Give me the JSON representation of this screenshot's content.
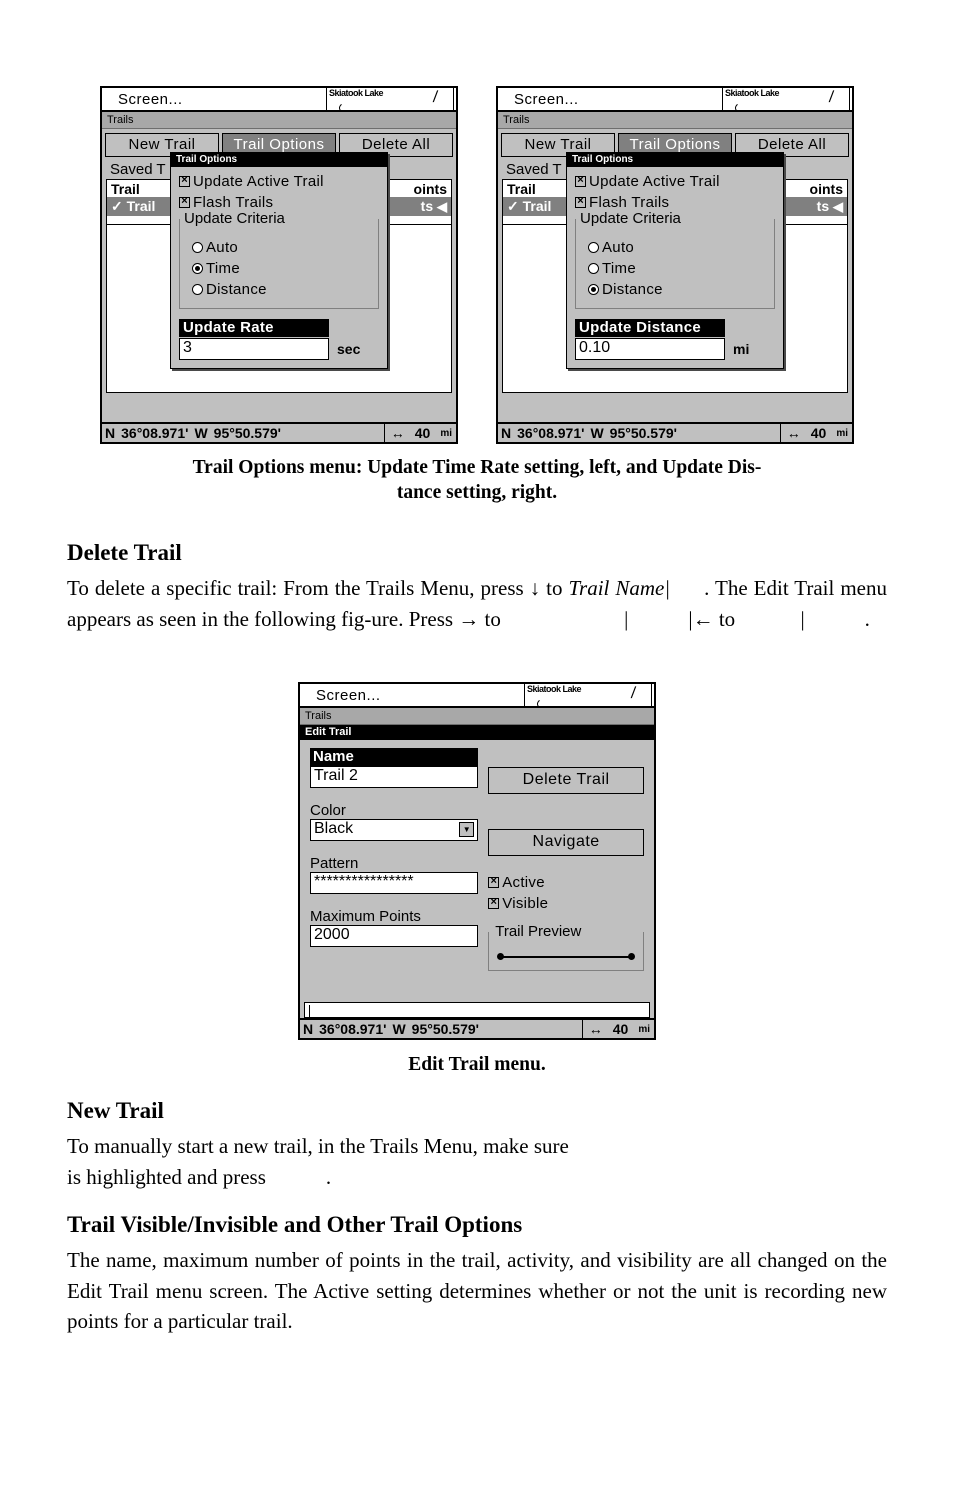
{
  "figures": {
    "trail_options_left": {
      "header_title": "Screen...",
      "map_label": "Skiatook Lake",
      "sub_title": "Trails",
      "buttons": [
        {
          "label": "New Trail",
          "selected": false
        },
        {
          "label": "Trail Options",
          "selected": true
        },
        {
          "label": "Delete All",
          "selected": false
        }
      ],
      "saved_label": "Saved T",
      "table_head_left": "Trail",
      "table_head_right": "oints",
      "table_row_left": "Trail",
      "table_row_right": "ts",
      "dialog": {
        "title": "Trail Options",
        "checkboxes": [
          {
            "label": "Update Active Trail",
            "checked": true
          },
          {
            "label": "Flash Trails",
            "checked": true
          }
        ],
        "group_legend": "Update Criteria",
        "radios": [
          {
            "label": "Auto",
            "selected": false
          },
          {
            "label": "Time",
            "selected": true
          },
          {
            "label": "Distance",
            "selected": false
          }
        ],
        "field_title": "Update Rate",
        "field_value": "3",
        "field_unit": "sec"
      },
      "status": {
        "lat_hemi": "N",
        "lat": "36°08.971'",
        "lon_hemi": "W",
        "lon": "95°50.579'",
        "range_icon": "↔",
        "range_value": "40",
        "range_unit": "mi"
      }
    },
    "trail_options_right": {
      "header_title": "Screen...",
      "map_label": "Skiatook Lake",
      "sub_title": "Trails",
      "buttons": [
        {
          "label": "New Trail",
          "selected": false
        },
        {
          "label": "Trail Options",
          "selected": true
        },
        {
          "label": "Delete All",
          "selected": false
        }
      ],
      "saved_label": "Saved T",
      "table_head_left": "Trail",
      "table_head_right": "oints",
      "table_row_left": "Trail",
      "table_row_right": "ts",
      "dialog": {
        "title": "Trail Options",
        "checkboxes": [
          {
            "label": "Update Active Trail",
            "checked": true
          },
          {
            "label": "Flash Trails",
            "checked": true
          }
        ],
        "group_legend": "Update Criteria",
        "radios": [
          {
            "label": "Auto",
            "selected": false
          },
          {
            "label": "Time",
            "selected": false
          },
          {
            "label": "Distance",
            "selected": true
          }
        ],
        "field_title": "Update Distance",
        "field_value": "0.10",
        "field_unit": "mi"
      },
      "status": {
        "lat_hemi": "N",
        "lat": "36°08.971'",
        "lon_hemi": "W",
        "lon": "95°50.579'",
        "range_icon": "↔",
        "range_value": "40",
        "range_unit": "mi"
      }
    },
    "edit_trail": {
      "header_title": "Screen...",
      "map_label": "Skiatook Lake",
      "sub_title": "Trails",
      "dialog_title": "Edit Trail",
      "name_label": "Name",
      "name_value": "Trail 2",
      "delete_button": "Delete Trail",
      "color_label": "Color",
      "color_value": "Black",
      "navigate_button": "Navigate",
      "pattern_label": "Pattern",
      "pattern_value": "****************",
      "active_label": "Active",
      "active_checked": true,
      "visible_label": "Visible",
      "visible_checked": true,
      "max_points_label": "Maximum Points",
      "max_points_value": "2000",
      "trail_preview_label": "Trail Preview",
      "status": {
        "lat_hemi": "N",
        "lat": "36°08.971'",
        "lon_hemi": "W",
        "lon": "95°50.579'",
        "range_icon": "↔",
        "range_value": "40",
        "range_unit": "mi"
      }
    }
  },
  "captions": {
    "figure1_line1": "Trail Options menu: Update Time Rate setting, left, and Update Dis-",
    "figure1_line2": "tance setting, right.",
    "figure2": "Edit Trail menu."
  },
  "sections": {
    "delete_trail": {
      "heading": "Delete Trail",
      "body_part1": "To delete a specific trail: From the Trails Menu, press ↓ to ",
      "body_italic1": "Trail Name",
      "body_bar1": "|",
      "body_part2": ". The Edit Trail menu appears as seen in the following fig-ure. Press → to ",
      "body_bar2": "|",
      "body_bar3": "|",
      "body_part3": "← to ",
      "body_bar4": "|",
      "body_part4": "."
    },
    "new_trail": {
      "heading": "New Trail",
      "body_line1": "To manually start a new trail, in the Trails Menu, make sure",
      "body_line2_a": "is highlighted and press",
      "body_line2_b": "."
    },
    "trail_visible": {
      "heading": "Trail Visible/Invisible and Other Trail Options",
      "body": "The name, maximum number of points in the trail, activity, and visibility are all changed on the Edit Trail menu screen. The Active setting determines whether or not the unit is recording new points for a particular trail."
    }
  }
}
